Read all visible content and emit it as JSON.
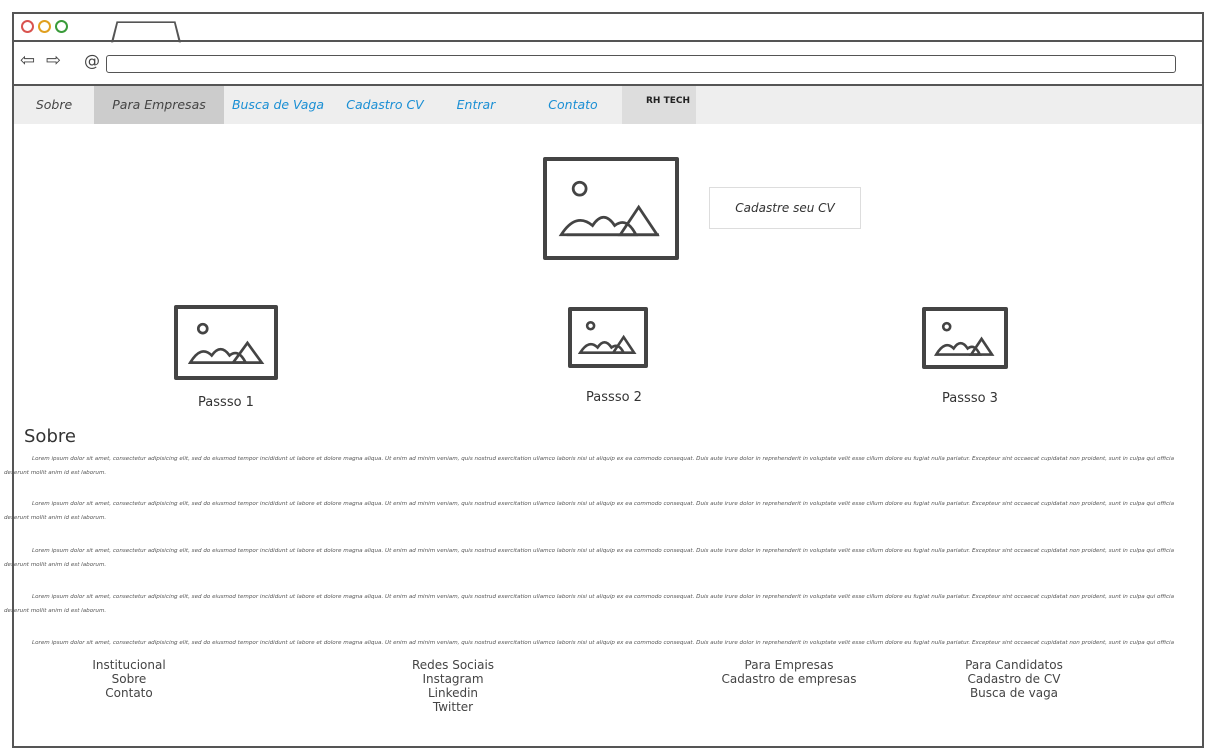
{
  "nav": {
    "items": [
      {
        "label": "Sobre",
        "style": "plain"
      },
      {
        "label": "Para Empresas",
        "style": "active"
      },
      {
        "label": "Busca de Vaga",
        "style": "link"
      },
      {
        "label": "Cadastro CV",
        "style": "link"
      },
      {
        "label": "Entrar",
        "style": "link"
      },
      {
        "label": "Contato",
        "style": "link"
      }
    ],
    "logo": "RH TECH"
  },
  "hero": {
    "button_label": "Cadastre seu CV"
  },
  "steps": [
    "Passso 1",
    "Passso 2",
    "Passso 3"
  ],
  "sobre": {
    "title": "Sobre",
    "paragraph": "Lorem ipsum dolor sit amet, consectetur adipisicing elit, sed do eiusmod tempor incididunt ut labore et dolore magna aliqua. Ut enim ad minim veniam, quis nostrud exercitation ullamco laboris nisi ut aliquip ex ea commodo consequat. Duis aute irure dolor in reprehenderit in voluptate velit esse cillum dolore eu fugiat nulla pariatur. Excepteur sint occaecat cupidatat non proident, sunt in culpa qui officia deserunt mollit anim id est laborum."
  },
  "footer": {
    "institucional": {
      "title": "Institucional",
      "links": [
        "Sobre",
        "Contato"
      ]
    },
    "redes": {
      "title": "Redes Sociais",
      "links": [
        "Instagram",
        "Linkedin",
        "Twitter"
      ]
    },
    "empresas": {
      "title": "Para Empresas",
      "links": [
        "Cadastro de empresas"
      ]
    },
    "candidatos": {
      "title": "Para Candidatos",
      "links": [
        "Cadastro de CV",
        "Busca de vaga"
      ]
    }
  },
  "icons": {
    "back": "back-arrow-icon",
    "forward": "forward-arrow-icon",
    "address": "at-sign-icon",
    "image": "image-placeholder-icon"
  },
  "colors": {
    "link": "#1a8fd4",
    "close": "#d9534f",
    "minimize": "#e0a020",
    "maximize": "#3a9b3a"
  }
}
